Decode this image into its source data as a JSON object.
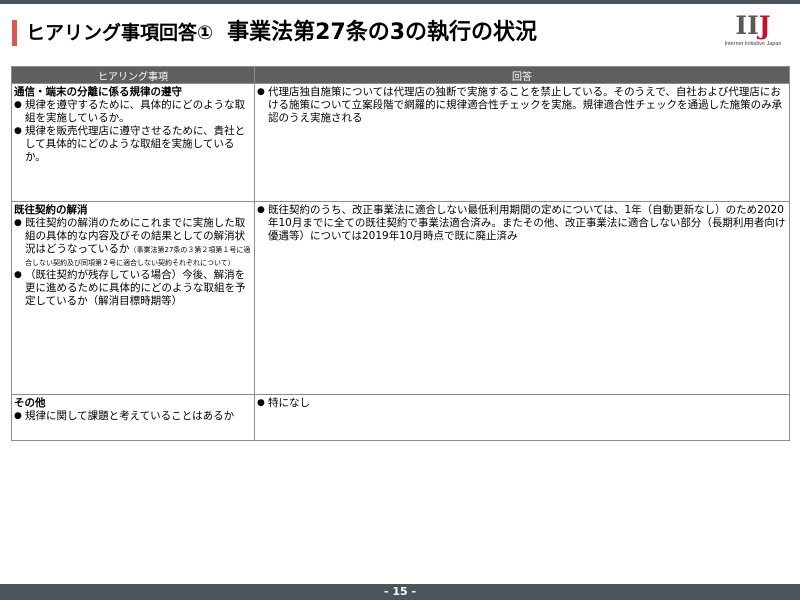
{
  "title": {
    "prefix": "ヒアリング事項回答①",
    "main": "事業法第27条の3の執行の状況"
  },
  "logo": {
    "mark_main": "II",
    "mark_j": "J",
    "subtitle": "Internet Initiative Japan"
  },
  "table": {
    "headers": [
      "ヒアリング事項",
      "回答"
    ],
    "rows": [
      {
        "heading": "通信・端末の分離に係る規律の遵守",
        "questions": [
          {
            "text": "規律を遵守するために、具体的にどのような取組を実施しているか。",
            "note": ""
          },
          {
            "text": "規律を販売代理店に遵守させるために、貴社として具体的にどのような取組を実施しているか。",
            "note": ""
          }
        ],
        "answers": [
          "代理店独自施策については代理店の独断で実施することを禁止している。そのうえで、自社および代理店における施策について立案段階で網羅的に規律適合性チェックを実施。規律適合性チェックを通過した施策のみ承認のうえ実施される"
        ]
      },
      {
        "heading": "既往契約の解消",
        "questions": [
          {
            "text": "既往契約の解消のためにこれまでに実施した取組の具体的な内容及びその結果としての解消状況はどうなっているか",
            "note": "（事業法第27条の３第２項第１号に適合しない契約及び同項第２号に適合しない契約それぞれについて）"
          },
          {
            "text": "（既往契約が残存している場合）今後、解消を更に進めるために具体的にどのような取組を予定しているか（解消目標時期等）",
            "note": ""
          }
        ],
        "answers": [
          "既往契約のうち、改正事業法に適合しない最低利用期間の定めについては、1年（自動更新なし）のため2020年10月までに全ての既往契約で事業法適合済み。またその他、改正事業法に適合しない部分（長期利用者向け優遇等）については2019年10月時点で既に廃止済み"
        ]
      },
      {
        "heading": "その他",
        "questions": [
          {
            "text": "規律に関して課題と考えていることはあるか",
            "note": ""
          }
        ],
        "answers": [
          "特になし"
        ]
      }
    ]
  },
  "footer": {
    "page_number": "- 15 -"
  },
  "colors": {
    "accent_bar": "#e0574f",
    "header_fill": "#5f5f5f",
    "rule": "#4d5459",
    "logo_j": "#c8102e"
  },
  "icons": {
    "bullet": "bullet-dot-icon"
  }
}
